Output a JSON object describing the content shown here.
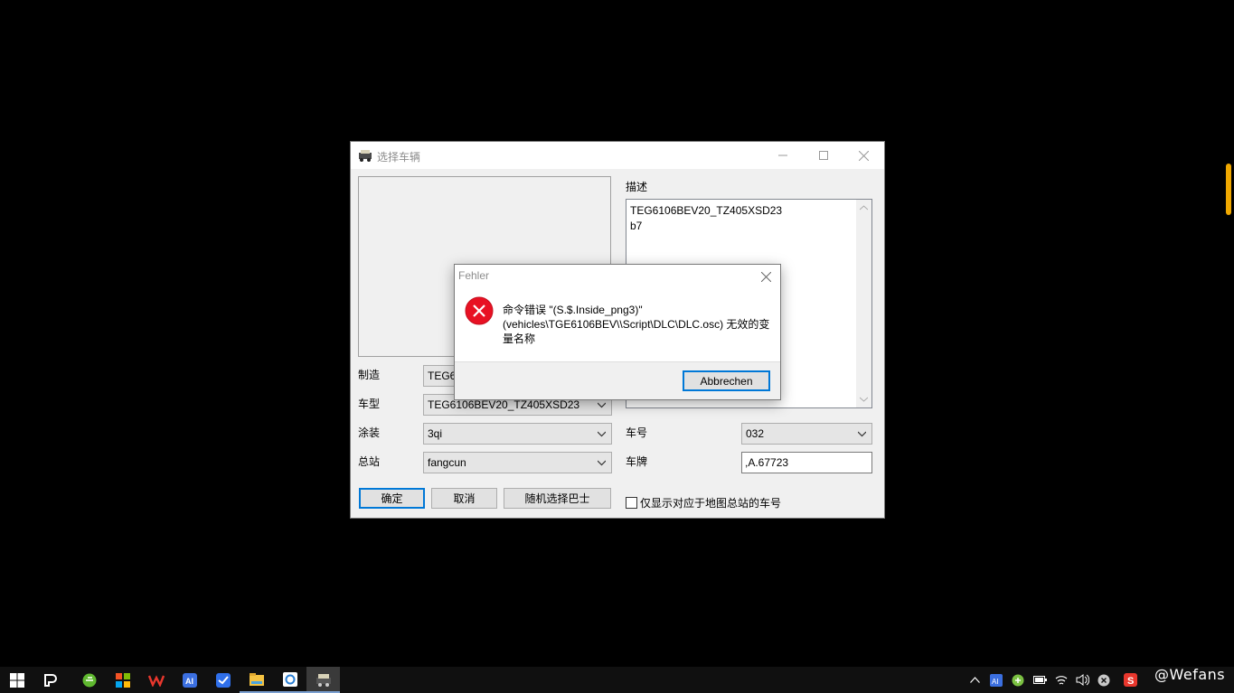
{
  "window": {
    "title": "选择车辆",
    "fields": {
      "maker_label": "制造",
      "maker_value": "TEG6",
      "model_label": "车型",
      "model_value": "TEG6106BEV20_TZ405XSD23",
      "paint_label": "涂装",
      "paint_value": "3qi",
      "depot_label": "总站",
      "depot_value": "fangcun",
      "number_label": "车号",
      "number_value": "032",
      "plate_label": "车牌",
      "plate_value": ",A.67723"
    },
    "description_label": "描述",
    "description_text": "TEG6106BEV20_TZ405XSD23\nb7",
    "buttons": {
      "ok": "确定",
      "cancel": "取消",
      "random": "随机选择巴士"
    },
    "checkbox_label": "仅显示对应于地图总站的车号"
  },
  "dialog": {
    "title": "Fehler",
    "message": "命令错误 \"(S.$.Inside_png3)\" (vehicles\\TGE6106BEV\\\\Script\\DLC\\DLC.osc) 无效的变量名称",
    "button": "Abbrechen"
  },
  "taskbar": {
    "items": [
      "windows-start-icon",
      "app-icon-1",
      "browser-icon",
      "app-icon-2",
      "wps-icon",
      "ai-icon",
      "feishu-icon",
      "file-explorer-icon",
      "map-app-icon",
      "omsi-icon"
    ]
  },
  "watermark": "@Wefans"
}
